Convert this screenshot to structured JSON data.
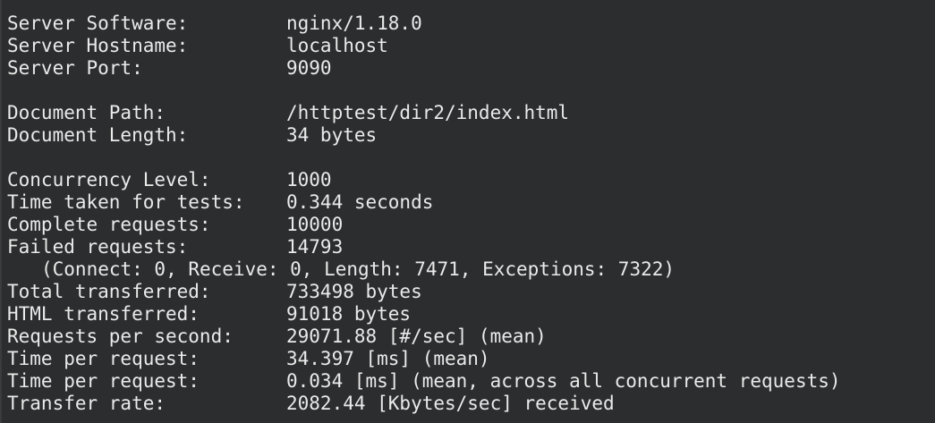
{
  "lines": [
    {
      "label": "Server Software:",
      "value": "nginx/1.18.0"
    },
    {
      "label": "Server Hostname:",
      "value": "localhost"
    },
    {
      "label": "Server Port:",
      "value": "9090"
    },
    {
      "label": "Document Path:",
      "value": "/httptest/dir2/index.html"
    },
    {
      "label": "Document Length:",
      "value": "34 bytes"
    },
    {
      "label": "Concurrency Level:",
      "value": "1000"
    },
    {
      "label": "Time taken for tests:",
      "value": "0.344 seconds"
    },
    {
      "label": "Complete requests:",
      "value": "10000"
    },
    {
      "label": "Failed requests:",
      "value": "14793"
    },
    {
      "note": "(Connect: 0, Receive: 0, Length: 7471, Exceptions: 7322)"
    },
    {
      "label": "Total transferred:",
      "value": "733498 bytes"
    },
    {
      "label": "HTML transferred:",
      "value": "91018 bytes"
    },
    {
      "label": "Requests per second:",
      "value": "29071.88 [#/sec] (mean)"
    },
    {
      "label": "Time per request:",
      "value": "34.397 [ms] (mean)"
    },
    {
      "label": "Time per request:",
      "value": "0.034 [ms] (mean, across all concurrent requests)"
    },
    {
      "label": "Transfer rate:",
      "value": "2082.44 [Kbytes/sec] received"
    }
  ],
  "colors": {
    "background": "#2b2d2e",
    "text": "#eaeaea"
  }
}
